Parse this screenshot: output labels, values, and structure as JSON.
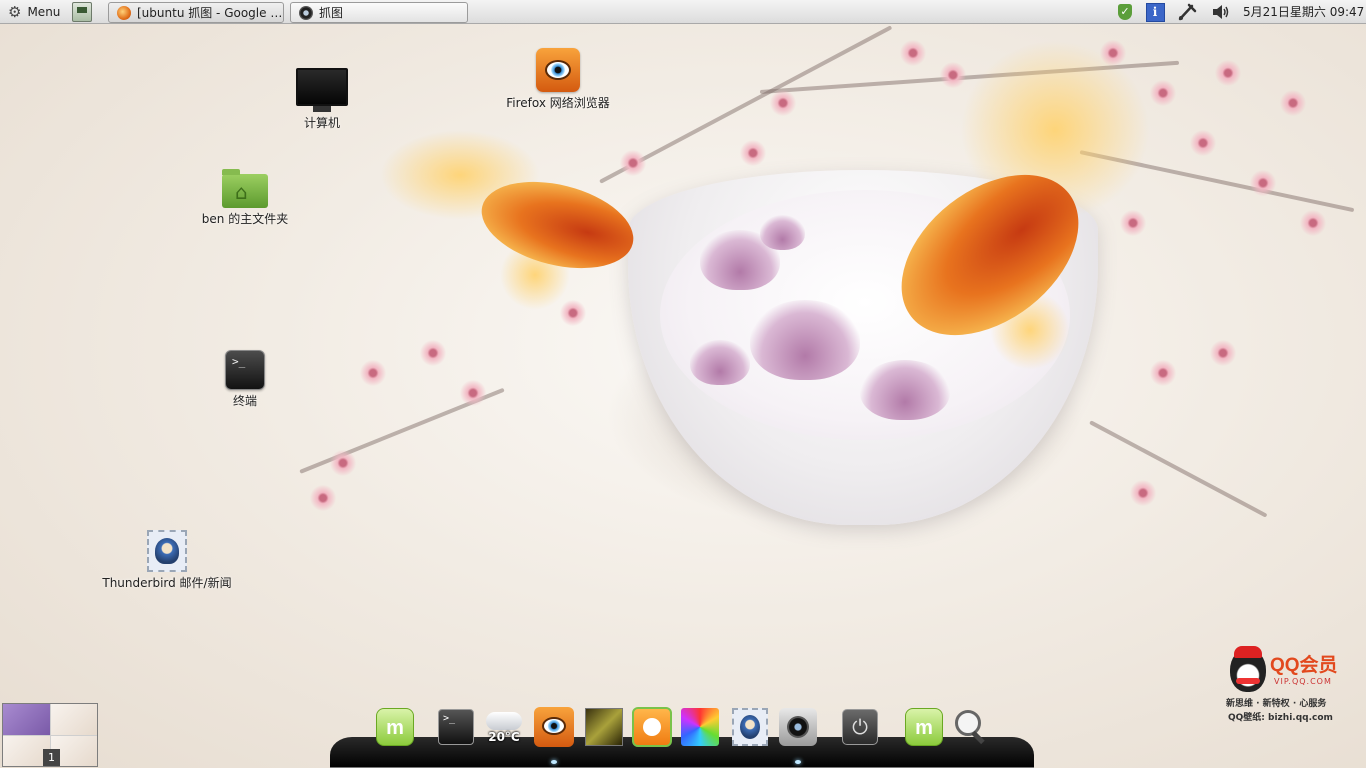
{
  "top_panel": {
    "menu_label": "Menu",
    "tasks": [
      {
        "title": "[ubuntu 抓图 - Google …",
        "icon": "firefox-icon"
      },
      {
        "title": "抓图",
        "icon": "screenshot-icon"
      }
    ],
    "tray": [
      "update-shield-icon",
      "info-icon",
      "network-icon",
      "volume-icon"
    ],
    "clock": "5月21日星期六 09:47"
  },
  "desktop_icons": [
    {
      "label": "计算机",
      "icon": "computer-icon"
    },
    {
      "label": "ben 的主文件夹",
      "icon": "home-folder-icon"
    },
    {
      "label": "终端",
      "icon": "terminal-icon"
    },
    {
      "label": "Firefox 网络浏览器",
      "icon": "firefox-icon"
    },
    {
      "label": "Thunderbird 邮件/新闻",
      "icon": "thunderbird-icon"
    }
  ],
  "workspace_switcher": {
    "active_workspace": "1"
  },
  "dock": {
    "items": [
      "mint-menu-icon",
      "terminal-icon",
      "weather-icon",
      "firefox-icon",
      "photo-viewer-icon",
      "pidgin-icon",
      "color-picker-icon",
      "thunderbird-icon",
      "camera-icon",
      "power-icon",
      "mint-menu-icon",
      "search-icon"
    ],
    "weather_temp": "20°C"
  },
  "watermark": {
    "title": "QQ会员",
    "url": "VIP.QQ.COM",
    "tagline": "新思维 · 新特权 · 心服务",
    "credit": "QQ壁纸: bizhi.qq.com"
  }
}
